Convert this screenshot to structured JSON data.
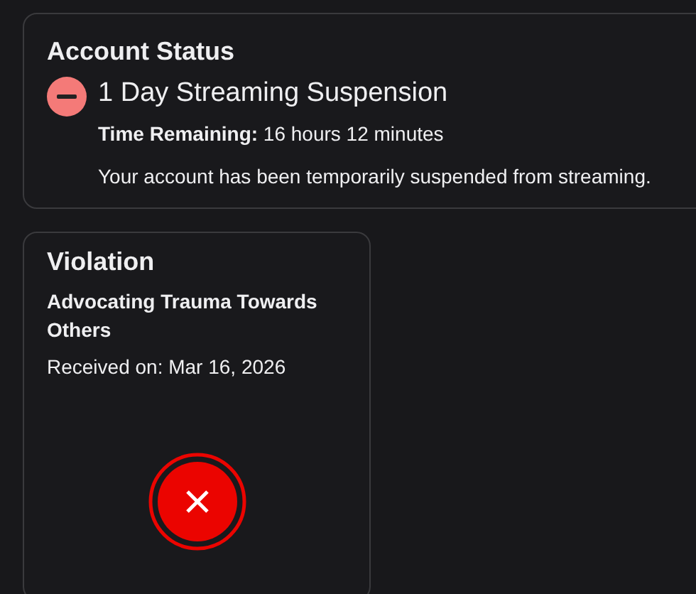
{
  "account_status": {
    "title": "Account Status",
    "suspension": "1 Day Streaming Suspension",
    "time_remaining": "**Time Remaining:** 16 hours 12 minutes",
    "message": "Your account has been temporarily suspended from streaming."
  },
  "violation": {
    "title": "Violation",
    "name": "Advocating Trauma Towards Others",
    "received": "Received on: Mar 16, 2026"
  }
}
